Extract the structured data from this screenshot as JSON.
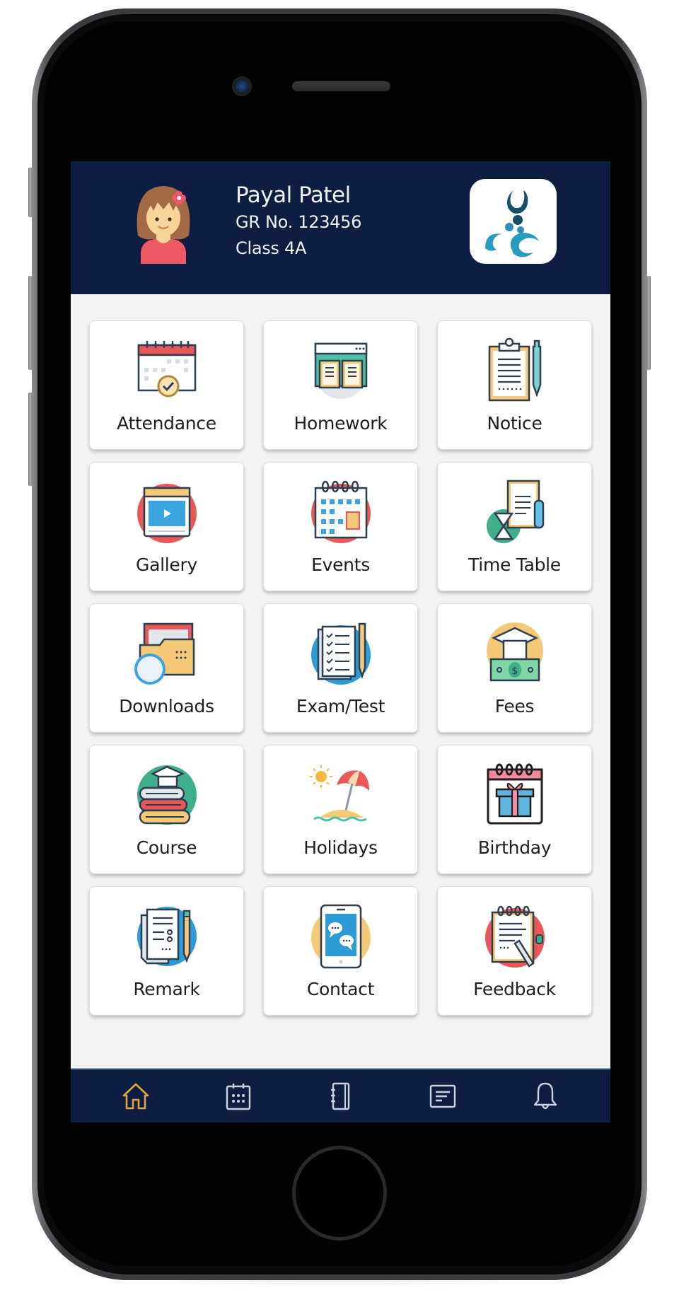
{
  "device": {
    "type": "phone-mockup"
  },
  "header": {
    "student_name": "Payal Patel",
    "gr_number": "GR No. 123456",
    "class_label": "Class 4A",
    "avatar_icon": "girl-avatar-icon",
    "logo_icon": "school-logo-icon"
  },
  "theme": {
    "header_bg": "#0e1d42",
    "screen_bg": "#f2f3f5",
    "tile_bg": "#ffffff",
    "nav_active": "#e2a341",
    "nav_inactive": "#c9d2de"
  },
  "grid": {
    "tiles": [
      {
        "label": "Attendance",
        "icon": "calendar-check-icon"
      },
      {
        "label": "Homework",
        "icon": "open-book-icon"
      },
      {
        "label": "Notice",
        "icon": "clipboard-pen-icon"
      },
      {
        "label": "Gallery",
        "icon": "video-player-icon"
      },
      {
        "label": "Events",
        "icon": "event-calendar-icon"
      },
      {
        "label": "Time Table",
        "icon": "hourglass-schedule-icon"
      },
      {
        "label": "Downloads",
        "icon": "folder-download-icon"
      },
      {
        "label": "Exam/Test",
        "icon": "checklist-pen-icon"
      },
      {
        "label": "Fees",
        "icon": "graduation-money-icon"
      },
      {
        "label": "Course",
        "icon": "books-stack-icon"
      },
      {
        "label": "Holidays",
        "icon": "beach-umbrella-icon"
      },
      {
        "label": "Birthday",
        "icon": "gift-calendar-icon"
      },
      {
        "label": "Remark",
        "icon": "document-pencil-icon"
      },
      {
        "label": "Contact",
        "icon": "tablet-chat-icon"
      },
      {
        "label": "Feedback",
        "icon": "notepad-pen-icon"
      }
    ]
  },
  "bottom_nav": {
    "items": [
      {
        "name": "home",
        "icon": "home-icon",
        "active": true
      },
      {
        "name": "calendar",
        "icon": "calendar-icon",
        "active": false
      },
      {
        "name": "notebook",
        "icon": "notebook-icon",
        "active": false
      },
      {
        "name": "notes",
        "icon": "notes-icon",
        "active": false
      },
      {
        "name": "notifications",
        "icon": "bell-icon",
        "active": false
      }
    ]
  }
}
